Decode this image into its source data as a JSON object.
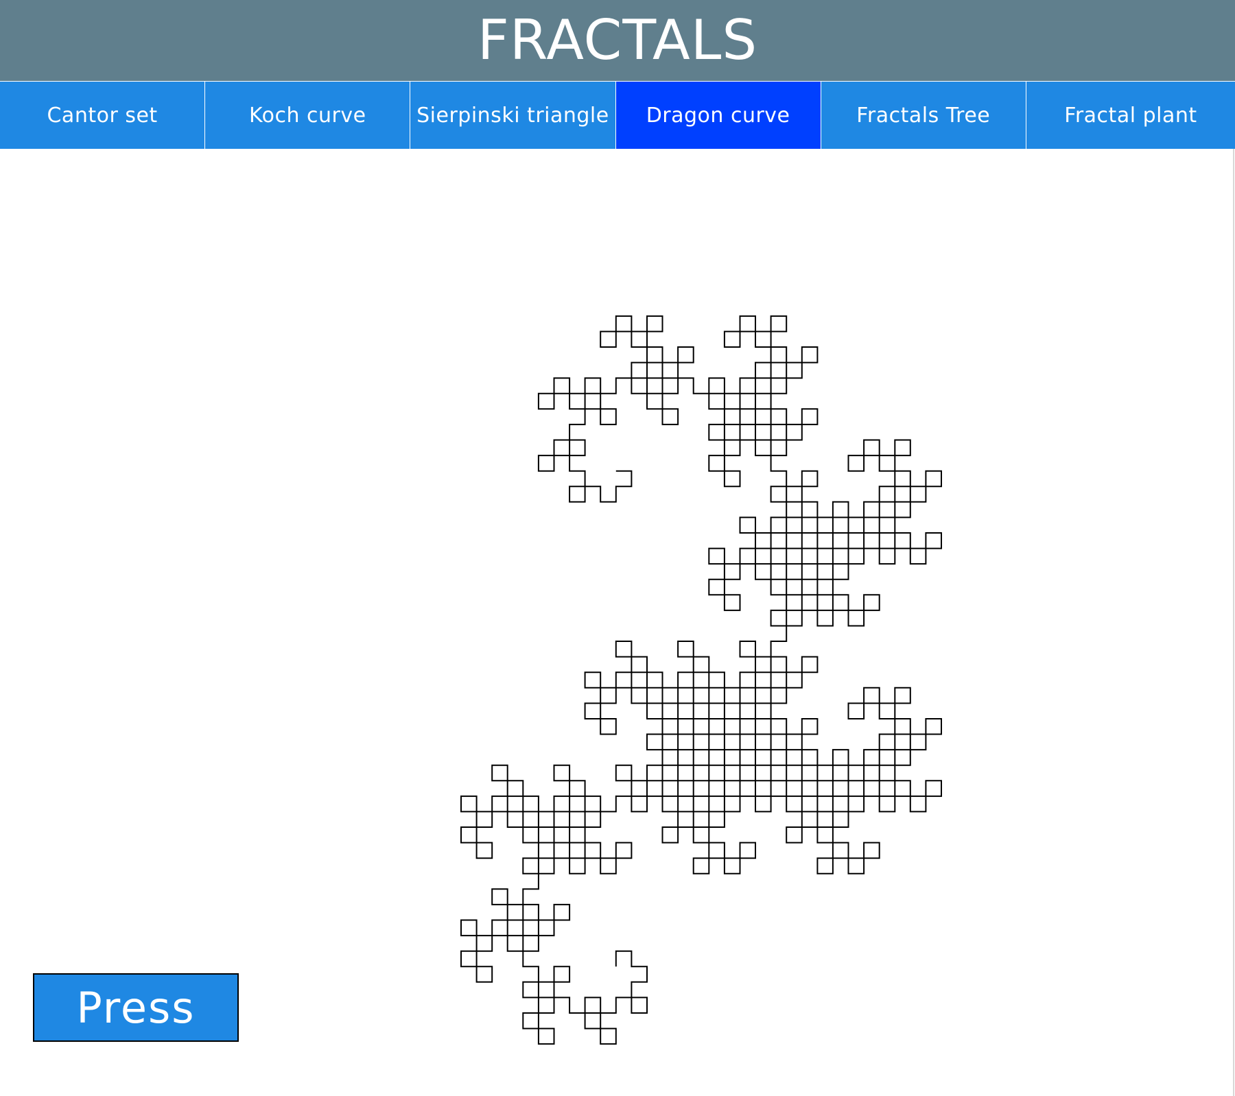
{
  "header": {
    "title": "FRACTALS"
  },
  "nav": {
    "items": [
      {
        "label": "Cantor set",
        "active": false
      },
      {
        "label": "Koch curve",
        "active": false
      },
      {
        "label": "Sierpinski triangle",
        "active": false
      },
      {
        "label": "Dragon curve",
        "active": true
      },
      {
        "label": "Fractals Tree",
        "active": false
      },
      {
        "label": "Fractal plant",
        "active": false
      }
    ]
  },
  "controls": {
    "press_label": "Press"
  },
  "fractal": {
    "type": "dragon-curve",
    "iterations": 10,
    "stroke_color": "#000000"
  },
  "colors": {
    "title_bar": "#607f8d",
    "nav_bg": "#1f88e3",
    "nav_active": "#0040ff",
    "button_bg": "#1f88e3"
  }
}
